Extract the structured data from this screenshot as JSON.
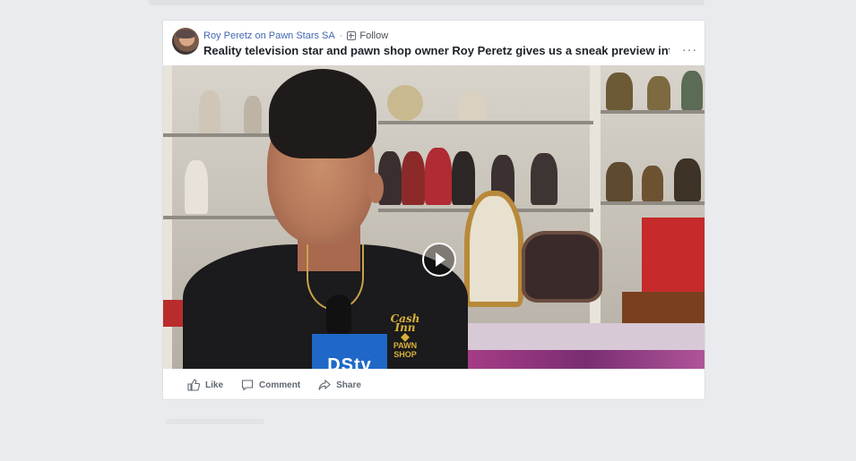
{
  "post": {
    "page_name": "Roy Peretz on Pawn Stars SA",
    "separator": "·",
    "follow_label": "Follow",
    "title": "Reality television star and pawn shop owner Roy Peretz gives us a sneak preview into his...",
    "more_label": "···"
  },
  "video": {
    "logo_line1": "Cash Inn",
    "logo_line2": "PAWN SHOP",
    "mic_label": "DStv"
  },
  "actions": {
    "like": "Like",
    "comment": "Comment",
    "share": "Share"
  }
}
